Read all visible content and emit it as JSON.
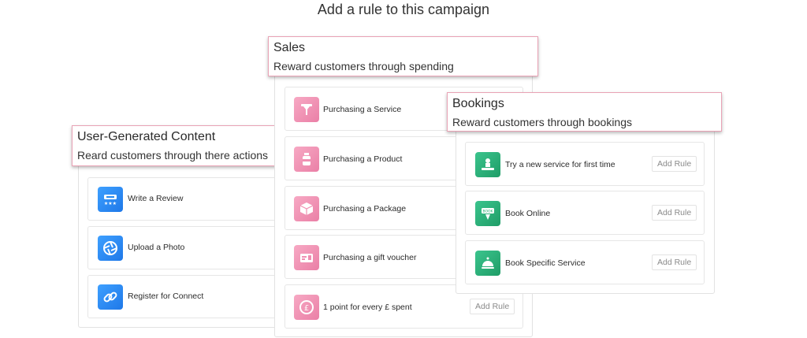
{
  "title": "Add a rule to this campaign",
  "add_rule_label": "Add Rule",
  "ugc": {
    "title": "User-Generated Content",
    "subtitle": "Reard customers through there actions",
    "items": [
      {
        "label": "Write a Review",
        "icon": "review-icon"
      },
      {
        "label": "Upload a Photo",
        "icon": "camera-aperture-icon"
      },
      {
        "label": "Register for Connect",
        "icon": "link-icon"
      }
    ]
  },
  "sales": {
    "title": "Sales",
    "subtitle": "Reward customers through spending",
    "items": [
      {
        "label": "Purchasing a Service",
        "icon": "service-icon"
      },
      {
        "label": "Purchasing a Product",
        "icon": "product-bottle-icon"
      },
      {
        "label": "Purchasing a Package",
        "icon": "package-box-icon"
      },
      {
        "label": "Purchasing a gift voucher",
        "icon": "gift-voucher-icon"
      },
      {
        "label": "1 point for every £ spent",
        "icon": "pound-coin-icon"
      }
    ]
  },
  "bookings": {
    "title": "Bookings",
    "subtitle": "Reward customers through bookings",
    "items": [
      {
        "label": "Try a new service for first time",
        "icon": "new-service-icon"
      },
      {
        "label": "Book Online",
        "icon": "book-online-icon"
      },
      {
        "label": "Book Specific Service",
        "icon": "service-bell-icon"
      }
    ]
  },
  "colors": {
    "ugc_icon": "#2388f0",
    "sales_icon": "#ef8fb2",
    "bookings_icon": "#27ad74",
    "header_border": "#e9a2b5"
  }
}
